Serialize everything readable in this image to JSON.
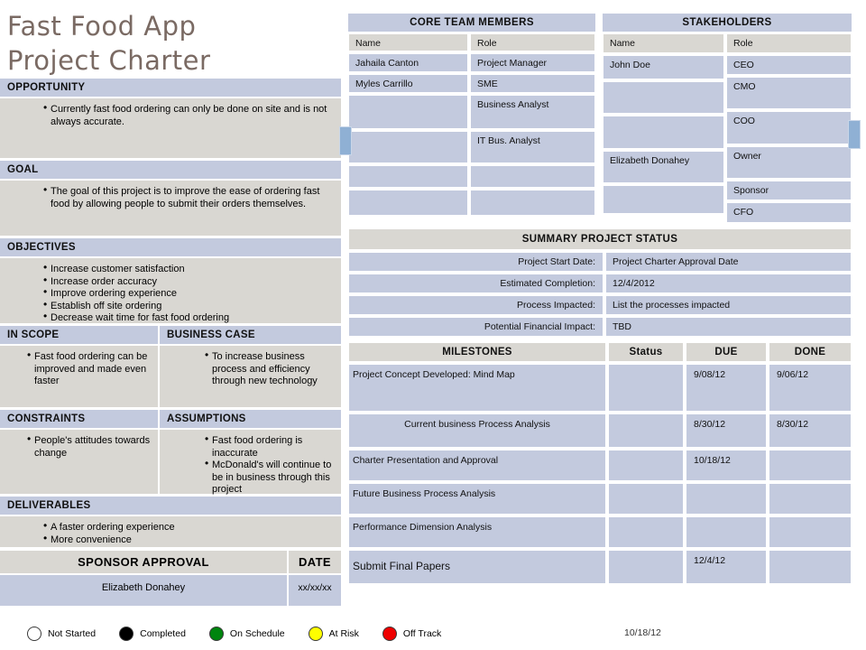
{
  "document": {
    "title": "Fast Food App\nProject Charter",
    "date_stamp": "10/18/12"
  },
  "sections": {
    "opportunity": {
      "heading": "OPPORTUNITY",
      "items": [
        "Currently fast food ordering can only be done on site and is not always accurate."
      ]
    },
    "goal": {
      "heading": "GOAL",
      "items": [
        "The goal of this project is to improve the ease of ordering fast food by allowing people to submit their orders themselves."
      ]
    },
    "objectives": {
      "heading": "OBJECTIVES",
      "items": [
        "Increase customer satisfaction",
        "Increase order accuracy",
        "Improve ordering experience",
        "Establish off site ordering",
        "Decrease wait time for fast food ordering"
      ]
    },
    "in_scope": {
      "heading": "IN SCOPE",
      "items": [
        "Fast food ordering can be improved and made even faster"
      ]
    },
    "business_case": {
      "heading": "BUSINESS CASE",
      "items": [
        "To increase business process and efficiency through new technology"
      ]
    },
    "constraints": {
      "heading": "CONSTRAINTS",
      "items": [
        "People's attitudes towards change"
      ]
    },
    "assumptions": {
      "heading": "ASSUMPTIONS",
      "items": [
        "Fast food ordering is inaccurate",
        "McDonald's will continue to be in business through this project"
      ]
    },
    "deliverables": {
      "heading": "DELIVERABLES",
      "items": [
        "A faster ordering experience",
        "More convenience"
      ]
    }
  },
  "sponsor_approval": {
    "heading": "SPONSOR APPROVAL",
    "date_heading": "DATE",
    "name": "Elizabeth Donahey",
    "date": "xx/xx/xx"
  },
  "legend": {
    "items": [
      {
        "label": "Not Started",
        "color": "#ffffff"
      },
      {
        "label": "Completed",
        "color": "#000000"
      },
      {
        "label": "On Schedule",
        "color": "#00850e"
      },
      {
        "label": "At Risk",
        "color": "#ffff00"
      },
      {
        "label": "Off Track",
        "color": "#ee0000"
      }
    ]
  },
  "core_team": {
    "title": "CORE TEAM MEMBERS",
    "headers": {
      "name": "Name",
      "role": "Role"
    },
    "names": [
      "Jahaila Canton",
      "Myles Carrillo",
      "",
      "",
      "",
      ""
    ],
    "roles": [
      "Project Manager",
      "SME",
      "Business Analyst",
      "IT Bus. Analyst",
      "",
      ""
    ]
  },
  "stakeholders": {
    "title": "STAKEHOLDERS",
    "headers": {
      "name": "Name",
      "role": "Role"
    },
    "names": [
      "John Doe",
      "",
      "",
      "Elizabeth Donahey",
      ""
    ],
    "roles": [
      "CEO",
      "CMO",
      "COO",
      "Owner",
      "Sponsor",
      "CFO"
    ]
  },
  "summary_status": {
    "title": "SUMMARY PROJECT STATUS",
    "rows": [
      {
        "label": "Project Start Date:",
        "value": "Project Charter Approval Date"
      },
      {
        "label": "Estimated Completion:",
        "value": "12/4/2012"
      },
      {
        "label": "Process Impacted:",
        "value": "List the processes impacted"
      },
      {
        "label": "Potential Financial Impact:",
        "value": "TBD"
      }
    ]
  },
  "milestones": {
    "headers": {
      "name": "MILESTONES",
      "status": "Status",
      "due": "DUE",
      "done": "DONE"
    },
    "rows": [
      {
        "name": "Project Concept Developed: Mind Map",
        "status": "",
        "due": "9/08/12",
        "done": "9/06/12"
      },
      {
        "name": "Current business Process Analysis",
        "status": "",
        "due": "8/30/12",
        "done": "8/30/12"
      },
      {
        "name": "Charter Presentation and Approval",
        "status": "",
        "due": "10/18/12",
        "done": ""
      },
      {
        "name": "Future Business Process Analysis",
        "status": "",
        "due": "",
        "done": ""
      },
      {
        "name": "Performance Dimension Analysis",
        "status": "",
        "due": "",
        "done": ""
      },
      {
        "name": "Submit Final Papers",
        "status": "",
        "due": "12/4/12",
        "done": ""
      }
    ]
  }
}
